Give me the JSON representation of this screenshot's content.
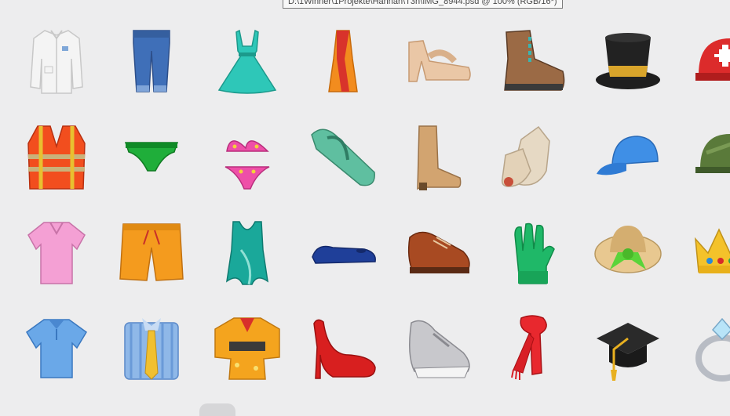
{
  "tooltip": {
    "text": "D:\\1Winner\\1Projekte\\Hannah\\T3n\\IMG_8944.psd @ 100% (RGB/16*)"
  },
  "colors": {
    "background": "#ededee",
    "tooltip_border": "#7a7a7a"
  },
  "emoji_rows": [
    [
      "lab-coat-icon",
      "jeans-icon",
      "dress-icon",
      "sari-icon",
      "sandal-icon",
      "hiking-boot-icon",
      "top-hat-icon",
      "rescue-helmet-icon"
    ],
    [
      "safety-vest-icon",
      "briefs-icon",
      "bikini-icon",
      "thong-sandal-icon",
      "womans-boot-icon",
      "socks-icon",
      "billed-cap-icon",
      "military-helmet-icon"
    ],
    [
      "womans-blouse-icon",
      "shorts-icon",
      "swimsuit-icon",
      "flat-shoe-icon",
      "mans-shoe-icon",
      "gloves-icon",
      "womans-hat-icon",
      "crown-icon"
    ],
    [
      "polo-shirt-icon",
      "shirt-and-tie-icon",
      "kimono-icon",
      "high-heel-icon",
      "running-shoe-icon",
      "scarf-icon",
      "graduation-cap-icon",
      "ring-icon"
    ]
  ]
}
